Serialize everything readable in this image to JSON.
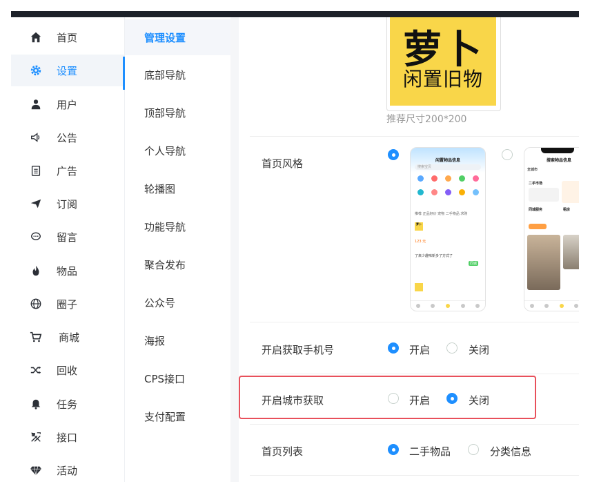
{
  "sidebar": {
    "items": [
      {
        "label": "首页",
        "icon": "home-icon"
      },
      {
        "label": "设置",
        "icon": "gear-icon"
      },
      {
        "label": "用户",
        "icon": "user-icon"
      },
      {
        "label": "公告",
        "icon": "speaker-icon"
      },
      {
        "label": "广告",
        "icon": "clipboard-icon"
      },
      {
        "label": "订阅",
        "icon": "paper-plane-icon"
      },
      {
        "label": "留言",
        "icon": "chat-bubble-icon"
      },
      {
        "label": "物品",
        "icon": "fire-icon"
      },
      {
        "label": "圈子",
        "icon": "globe-icon"
      },
      {
        "label": "商城",
        "icon": "cart-icon"
      },
      {
        "label": "回收",
        "icon": "shuffle-icon"
      },
      {
        "label": "任务",
        "icon": "bell-icon"
      },
      {
        "label": "接口",
        "icon": "tools-icon"
      },
      {
        "label": "活动",
        "icon": "diamond-icon"
      }
    ],
    "active_index": 1
  },
  "subnav": {
    "items": [
      "管理设置",
      "底部导航",
      "顶部导航",
      "个人导航",
      "轮播图",
      "功能导航",
      "聚合发布",
      "公众号",
      "海报",
      "CPS接口",
      "支付配置"
    ]
  },
  "logo": {
    "big_text": "萝卜",
    "small_text": "闲置旧物",
    "hint": "推荐尺寸200*200"
  },
  "settings": {
    "homepage_style": {
      "label": "首页风格",
      "selected": 0
    },
    "phone_number": {
      "label": "开启获取手机号",
      "options": [
        "开启",
        "关闭"
      ],
      "selected": 0
    },
    "city_fetch": {
      "label": "开启城市获取",
      "options": [
        "开启",
        "关闭"
      ],
      "selected": 1
    },
    "homepage_list": {
      "label": "首页列表",
      "options": [
        "二手物品",
        "分类信息"
      ],
      "selected": 0
    }
  },
  "preview1": {
    "title": "闲置物品信息",
    "search": "搜索宝贝",
    "tabs": "推荐   正品好价   宠物   二手物品   求购",
    "card_name": "萝卜",
    "card_price": "123 元",
    "card_desc": "了来少趣味新多了方式了",
    "badge": "同城"
  },
  "preview2": {
    "title": "搜索物品信息",
    "city": "全城市",
    "section1": "二手市场",
    "section2": "同城服务",
    "section3": "租房"
  },
  "colors": {
    "accent": "#1e8fff",
    "highlight_border": "#e8505b",
    "logo_bg": "#f9d649",
    "topbar": "#1d2129"
  }
}
